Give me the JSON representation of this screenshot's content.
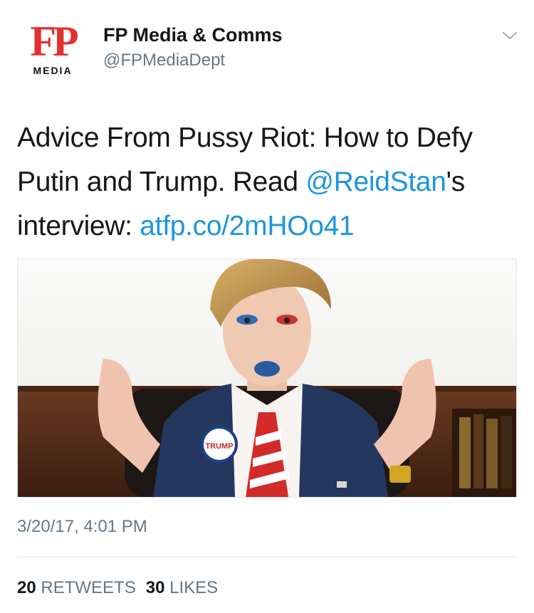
{
  "account": {
    "logo_letters": "FP",
    "logo_sub": "MEDIA",
    "display_name": "FP Media & Comms",
    "handle": "@FPMediaDept"
  },
  "tweet": {
    "line1": "Advice From Pussy Riot: How to Defy",
    "line2_a": "Putin and Trump. Read ",
    "mention": "@ReidStan",
    "line2_b": "'s",
    "line3_a": "interview: ",
    "url": "atfp.co/2mHOo41"
  },
  "media": {
    "badge_text": "TRUMP"
  },
  "timestamp": "3/20/17, 4:01 PM",
  "stats": {
    "retweets_count": "20",
    "retweets_label": "RETWEETS",
    "likes_count": "30",
    "likes_label": "LIKES"
  },
  "colors": {
    "link": "#1b95e0",
    "secondary_text": "#657786",
    "logo_red": "#e3302f"
  },
  "icons": {
    "menu": "chevron-down-icon"
  }
}
